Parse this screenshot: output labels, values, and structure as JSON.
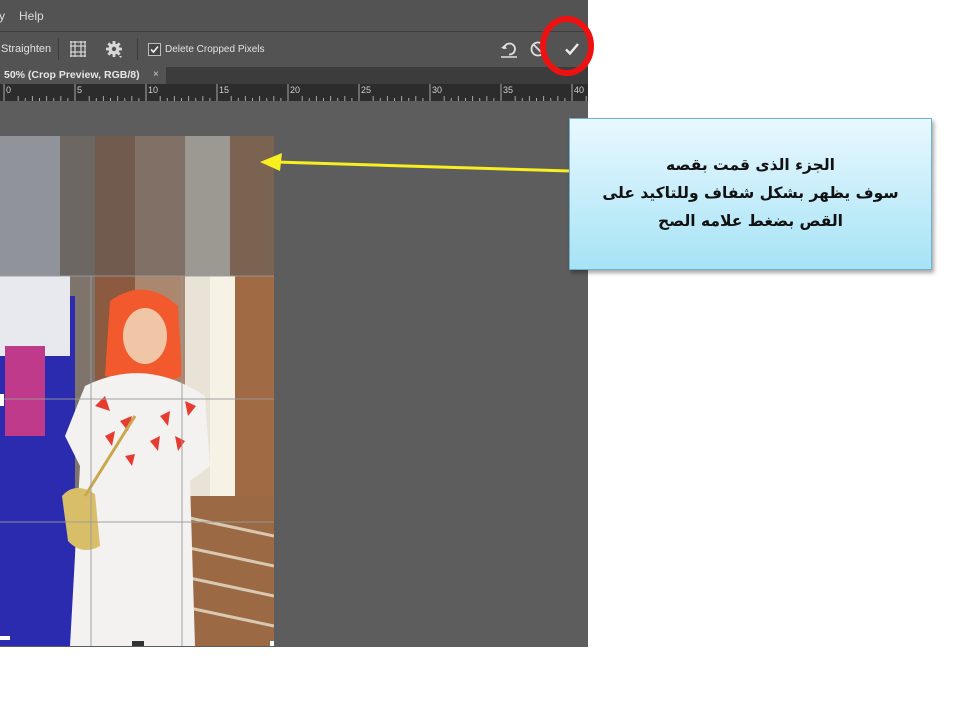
{
  "menubar": {
    "items": [
      "y",
      "Help"
    ]
  },
  "options_bar": {
    "straighten_label": "Straighten",
    "grid_overlay_icon": "grid-icon",
    "settings_icon": "gear-icon",
    "delete_cropped_pixels": {
      "label": "Delete Cropped Pixels",
      "checked": true
    },
    "reset_icon": "undo-icon",
    "cancel_icon": "cancel-icon",
    "commit_icon": "checkmark-icon"
  },
  "document_tab": {
    "label": "50% (Crop Preview, RGB/8)",
    "close": "×"
  },
  "ruler": {
    "ticks": [
      "0",
      "5",
      "10",
      "15",
      "20",
      "25",
      "30",
      "35",
      "40"
    ]
  },
  "annotation": {
    "lines": [
      "الجزء الذى قمت بقصه",
      "سوف يظهر بشكل شفاف وللتاكيد على",
      "القص بضغط علامه الصح"
    ],
    "arrow_color": "#f7ef1f",
    "highlight_color": "#ee1111"
  },
  "colors": {
    "ui_bg": "#535353",
    "canvas_bg": "#5d5d5d",
    "callout_top": "#e9f8ff",
    "callout_bottom": "#a6e3f5"
  }
}
